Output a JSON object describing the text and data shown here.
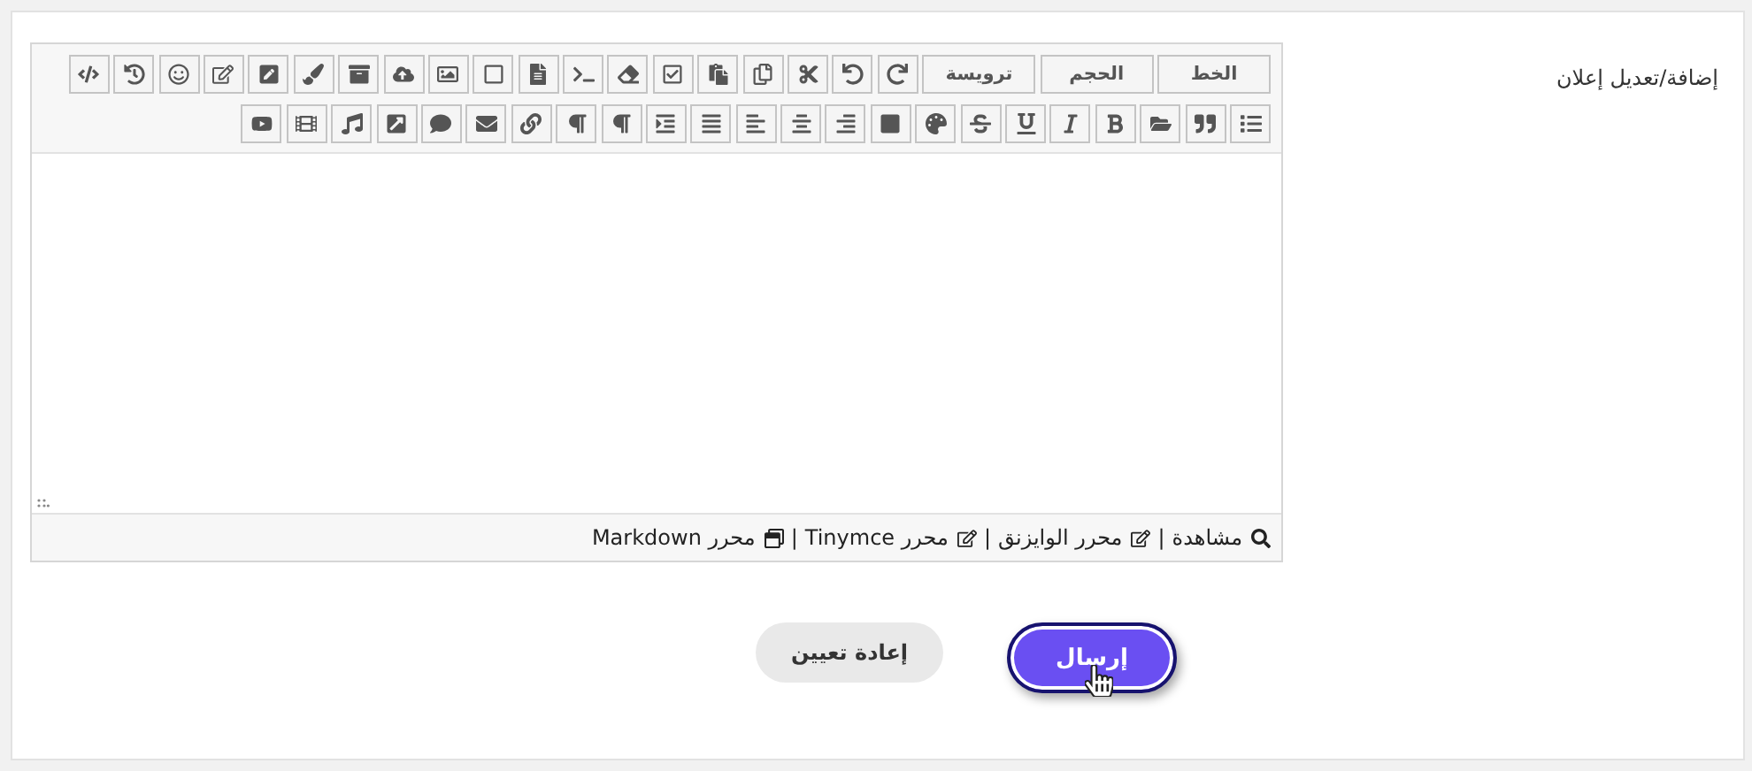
{
  "field_label": "إضافة/تعديل إعلان",
  "toolbar": {
    "menus": [
      "الخط",
      "الحجم",
      "ترويسة"
    ]
  },
  "editor_modes": [
    {
      "kind": "preview",
      "label": "مشاهدة"
    },
    {
      "kind": "separator",
      "label": "|"
    },
    {
      "kind": "edit",
      "label": "محرر الوايزنق"
    },
    {
      "kind": "separator",
      "label": "|"
    },
    {
      "kind": "edit",
      "label": "محرر Tinymce"
    },
    {
      "kind": "separator",
      "label": "|"
    },
    {
      "kind": "window",
      "label": "محرر Markdown"
    }
  ],
  "buttons": [
    {
      "kind": "submit",
      "label": "إرسال"
    },
    {
      "kind": "reset",
      "label": "إعادة تعيين"
    }
  ]
}
